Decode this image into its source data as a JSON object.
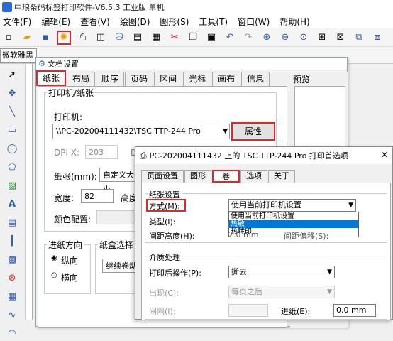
{
  "app": {
    "title": "中琅条码标签打印软件-V6.5.3 工业版 单机"
  },
  "menu": [
    "文件(F)",
    "编辑(E)",
    "查看(V)",
    "绘图(D)",
    "图形(S)",
    "工具(T)",
    "窗口(W)",
    "帮助(H)"
  ],
  "toolbar": {
    "font_name": "微软雅黑"
  },
  "doc_settings": {
    "title": "文档设置",
    "tabs": [
      "纸张",
      "布局",
      "顺序",
      "页码",
      "区间",
      "光标",
      "画布",
      "信息"
    ],
    "preview_label": "预览",
    "printer_group": "打印机/纸张",
    "printer_label": "打印机:",
    "printer_value": "\\\\PC-202004111432\\TSC TTP-244 Pro",
    "properties_button": "属性",
    "dpi_x_label": "DPI-X:",
    "dpi_x_value": "203",
    "dpi_y_label": "D",
    "paper_label": "纸张(mm):",
    "paper_value": "自定义大小",
    "width_label": "宽度:",
    "width_value": "82",
    "height_label": "高度",
    "color_label": "颜色配置:",
    "direction_group": "进纸方向",
    "dir_portrait": "纵向",
    "dir_landscape": "横向",
    "tray_group": "纸盒选择",
    "tray_value": "继续卷动"
  },
  "printer_prefs": {
    "title": "PC-202004111432 上的 TSC TTP-244 Pro 打印首选项",
    "tabs": [
      "页面设置",
      "图形",
      "卷",
      "选项",
      "关于"
    ],
    "paper_settings_group": "纸张设置",
    "method_label": "方式(M):",
    "method_value": "使用当前打印机设置",
    "method_options": [
      "使用当前打印机设置",
      "热敏",
      "热转印"
    ],
    "type_label": "类型(I):",
    "gap_label": "间距高度(H):",
    "gap_value": "2.0 mm",
    "gap_offset_label": "间距偏移(S):",
    "media_group": "介质处理",
    "post_print_label": "打印后操作(P):",
    "post_print_value": "撕去",
    "occur_label": "出现(C):",
    "occur_value": "每页之后",
    "interval_label": "间隔(I):",
    "feed_label": "进纸(E):",
    "feed_value": "0.0 mm"
  }
}
